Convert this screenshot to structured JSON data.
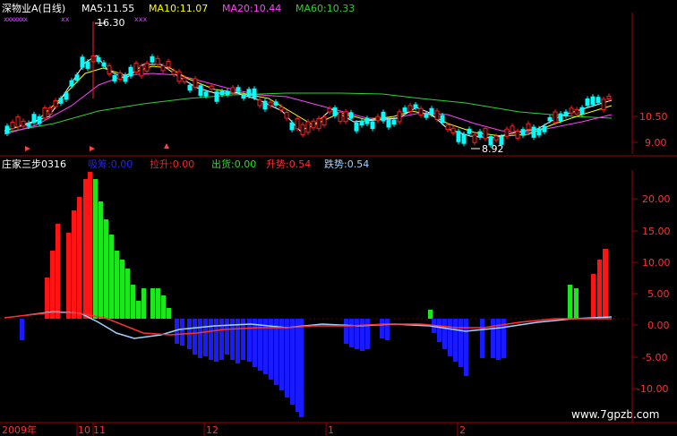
{
  "header": {
    "title": "深物业A(日线)",
    "ma5": "MA5:11.55",
    "ma10": "MA10:11.07",
    "ma20": "MA20:10.44",
    "ma60": "MA60:10.33"
  },
  "price_panel": {
    "high_note": "16.30",
    "low_note": "8.92",
    "axis_labels": [
      "10.50",
      "9.00"
    ],
    "x_marks": "xxxxxxx",
    "x_marks_2": "xx",
    "x_marks_3": "xxx"
  },
  "indicator_panel": {
    "name": "庄家三步0316",
    "items": [
      {
        "label": "吸筹:0.00",
        "color": "#2020ff"
      },
      {
        "label": "拉升:0.00",
        "color": "#ff2020"
      },
      {
        "label": "出货:0.00",
        "color": "#20e020"
      },
      {
        "label": "升势:0.54",
        "color": "#ff3030"
      },
      {
        "label": "跌势:0.54",
        "color": "#9fd4ff"
      }
    ],
    "axis_labels": [
      "20.00",
      "15.00",
      "10.00",
      "5.00",
      "0.00",
      "-5.00",
      "-10.00"
    ]
  },
  "date_axis": {
    "labels": [
      "2009年",
      "10",
      "11",
      "12",
      "1",
      "2"
    ]
  },
  "watermark": "www.7gpzb.com",
  "colors": {
    "ma5": "#ffffff",
    "ma10": "#ffff00",
    "ma20": "#ff40ff",
    "ma60": "#30d030",
    "up": "#ff2020",
    "down": "#00ffff",
    "grid": "#a00000",
    "axis_text": "#ff3030",
    "blue_bar": "#1a1aff",
    "green_bar": "#1ee61e",
    "red_bar": "#ff1414"
  }
}
